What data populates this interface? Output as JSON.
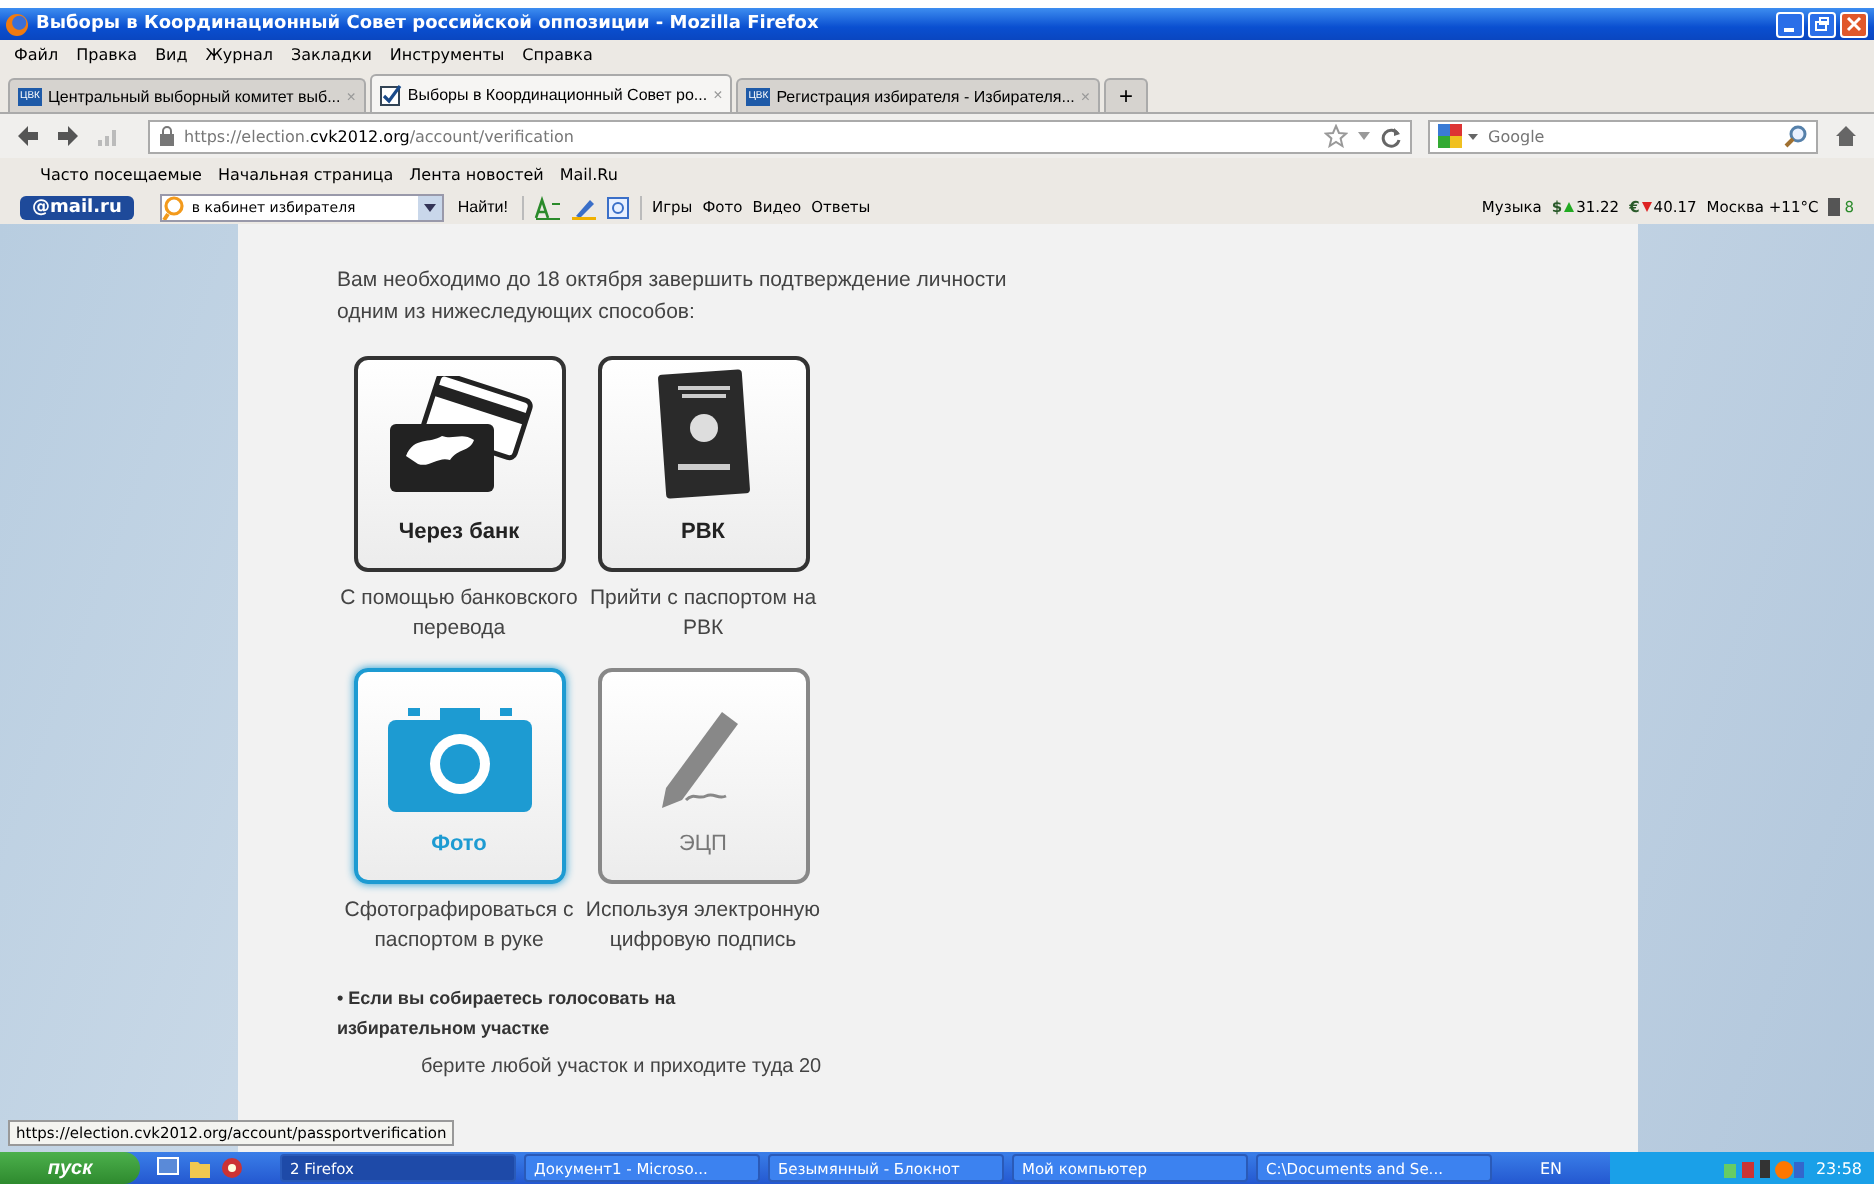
{
  "window": {
    "title": "Выборы в Координационный Совет российской оппозиции - Mozilla Firefox"
  },
  "menu": [
    "Файл",
    "Правка",
    "Вид",
    "Журнал",
    "Закладки",
    "Инструменты",
    "Справка"
  ],
  "tabs": [
    {
      "label": "Центральный выборный комитет выб...",
      "selected": false,
      "kind": "site",
      "icon_text": "ЦВК",
      "close": "×"
    },
    {
      "label": "Выборы в Координационный Совет ро...",
      "selected": true,
      "kind": "page",
      "close": "×"
    },
    {
      "label": "Регистрация избирателя - Избирателя...",
      "selected": false,
      "kind": "site",
      "icon_text": "ЦВК",
      "close": "×"
    }
  ],
  "new_tab": "+",
  "address": {
    "host_pre": "https://election.",
    "host": "cvk2012.org",
    "path": "/account/verification"
  },
  "search": {
    "placeholder": "Google"
  },
  "bookmarks": [
    "Часто посещаемые",
    "Начальная страница",
    "Лента новостей",
    "Mail.Ru"
  ],
  "mail_toolbar": {
    "logo": "@mail.ru",
    "search_value": "в кабинет избирателя",
    "find": "Найти!",
    "links": [
      "Игры",
      "Фото",
      "Видео",
      "Ответы"
    ],
    "music": "Музыка",
    "usd_sign": "$",
    "usd": "31.22",
    "eur_sign": "€",
    "eur": "40.17",
    "weather": "Москва +11°C",
    "traffic": "8"
  },
  "page": {
    "intro": "Вам необходимо до 18 октября завершить подтверждение личности одним из нижеследующих способов:",
    "options": [
      {
        "kind": "bank",
        "label": "Через банк",
        "caption": "С помощью банковского перевода",
        "selected": false,
        "disabled": false
      },
      {
        "kind": "passport",
        "label": "РВК",
        "caption": "Прийти с паспортом на РВК",
        "selected": false,
        "disabled": false
      },
      {
        "kind": "camera",
        "label": "Фото",
        "caption": "Сфотографироваться с паспортом в руке",
        "selected": true,
        "disabled": false
      },
      {
        "kind": "pen",
        "label": "ЭЦП",
        "caption": "Используя электронную цифровую подпись",
        "selected": false,
        "disabled": true
      }
    ],
    "bullet": "• Если вы собираетесь голосовать на избирательном участке",
    "tail": "берите любой участок и приходите туда 20"
  },
  "status_bar": "https://election.cvk2012.org/account/passportverification",
  "taskbar": {
    "start": "пуск",
    "tasks": [
      {
        "label": "2 Firefox",
        "selected": true
      },
      {
        "label": "Документ1 - Microso...",
        "selected": false
      },
      {
        "label": "Безымянный - Блокнот",
        "selected": false
      },
      {
        "label": "Мой компьютер",
        "selected": false
      },
      {
        "label": "C:\\Documents and Se...",
        "selected": false
      }
    ],
    "lang": "EN",
    "clock": "23:58"
  }
}
